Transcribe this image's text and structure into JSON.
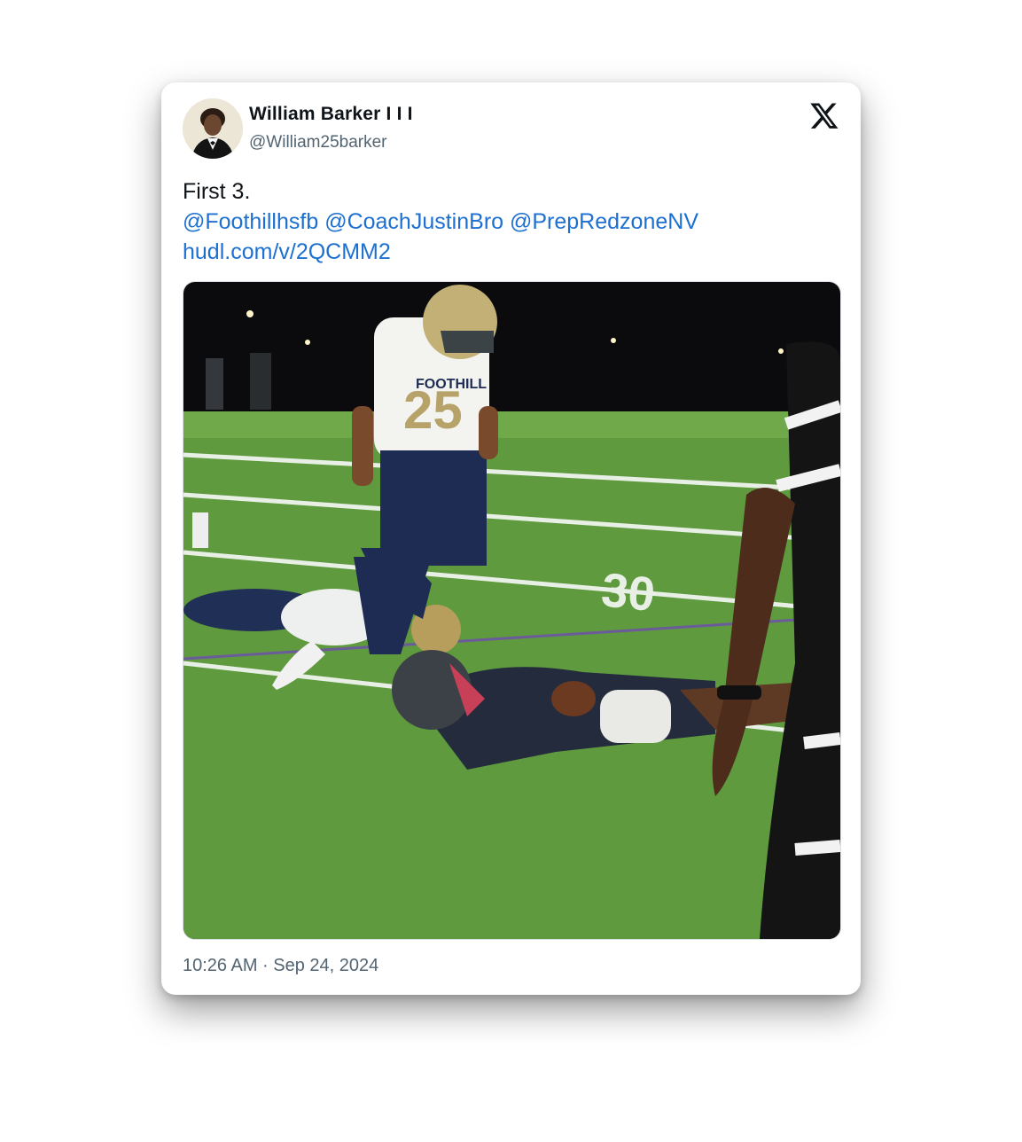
{
  "tweet": {
    "display_name": "William Barker I I I",
    "handle": "@William25barker",
    "text_line1": "First 3.",
    "mentions": [
      "@Foothillhsfb",
      "@CoachJustinBro",
      "@PrepRedzoneNV"
    ],
    "link": "hudl.com/v/2QCMM2",
    "timestamp": "10:26 AM · Sep 24, 2024"
  },
  "icons": {
    "platform": "x-logo-icon",
    "avatar": "avatar-photo"
  },
  "media": {
    "jersey_number": "25",
    "jersey_team": "FOOTHILL",
    "field_number": "30"
  },
  "colors": {
    "link": "#1d70d1",
    "text": "#0f1419",
    "secondary": "#536471"
  }
}
